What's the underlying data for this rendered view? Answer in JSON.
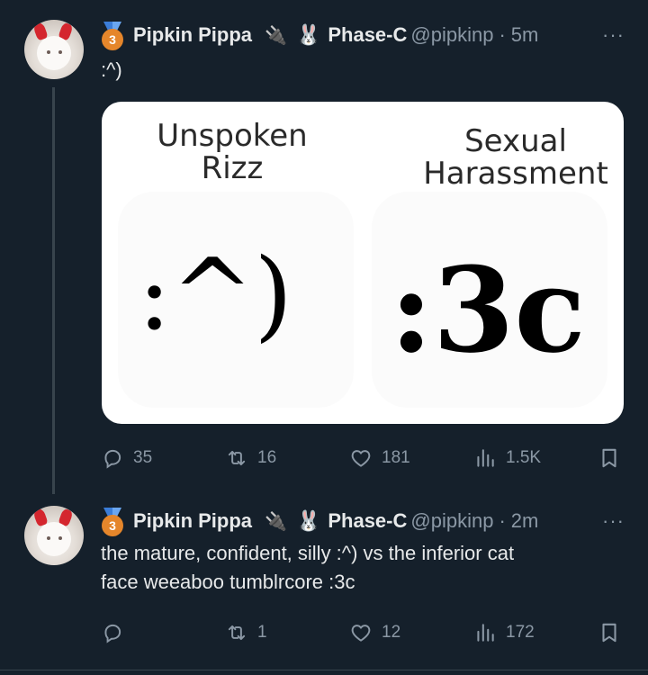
{
  "tweets": [
    {
      "author": {
        "name": "Pipkin Pippa",
        "badge_number": "3",
        "plug_emoji": "🔌",
        "bunny_emoji": "🐰",
        "affiliation": "Phase-C",
        "handle": "@pipkinp"
      },
      "time": "5m",
      "text": ":^)",
      "media": {
        "left_label_1": "Unspoken",
        "left_label_2": "Rizz",
        "left_face": ":^)",
        "right_label_1": "Sexual",
        "right_label_2": "Harassment",
        "right_face": ":3c"
      },
      "stats": {
        "replies": "35",
        "retweets": "16",
        "likes": "181",
        "views": "1.5K"
      }
    },
    {
      "author": {
        "name": "Pipkin Pippa",
        "badge_number": "3",
        "plug_emoji": "🔌",
        "bunny_emoji": "🐰",
        "affiliation": "Phase-C",
        "handle": "@pipkinp"
      },
      "time": "2m",
      "text_line_1": "the mature, confident, silly :^) vs the inferior cat",
      "text_line_2": "face weeaboo tumblrcore :3c",
      "stats": {
        "replies": "",
        "retweets": "1",
        "likes": "12",
        "views": "172"
      }
    }
  ],
  "ui": {
    "more": "···",
    "dot": "·"
  },
  "colors": {
    "background": "#15202b",
    "text": "#e7e9ea",
    "muted": "#8b98a5",
    "divider": "#38444d"
  }
}
